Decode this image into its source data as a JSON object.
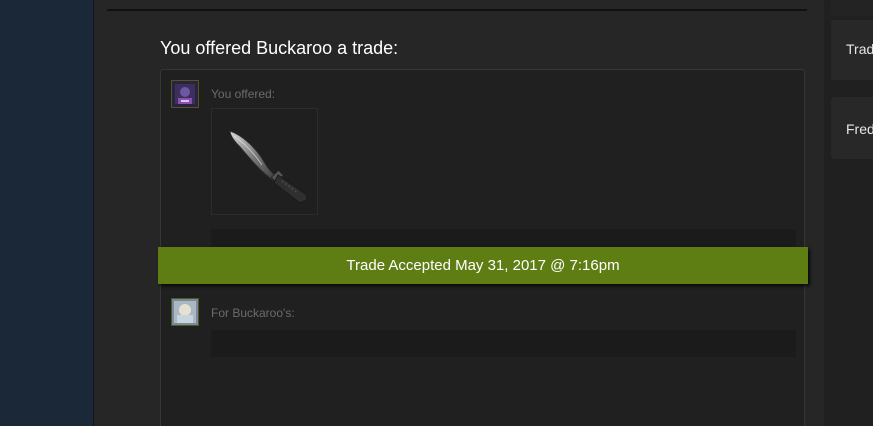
{
  "trade": {
    "heading": "You offered Buckaroo a trade:",
    "you_offered_label": "You offered:",
    "for_them_label": "For Buckaroo's:",
    "status": "Trade Accepted May 31, 2017 @ 7:16pm",
    "status_color": "#5e7e14",
    "offered_item_icon": "knife-icon"
  },
  "sidebar": {
    "cards": [
      {
        "label": "Trad"
      },
      {
        "label": "Fred"
      }
    ]
  }
}
